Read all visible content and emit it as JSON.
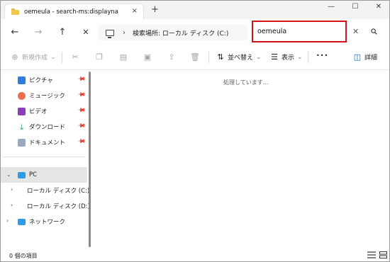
{
  "window": {
    "tab_title": "oemeula - search-ms:displayna",
    "tab_close": "×",
    "new_tab": "+",
    "controls": {
      "minimize": "—",
      "maximize": "☐",
      "close": "✕"
    }
  },
  "nav": {
    "back": "←",
    "forward": "→",
    "up": "↑",
    "stop": "✕",
    "address_chevron": "›",
    "address_text": "検索場所: ローカル ディスク (C:)",
    "search_value": "oemeula",
    "search_clear": "✕"
  },
  "commands": {
    "new": "新規作成",
    "new_chevron": "⌄",
    "sort": "並べ替え",
    "sort_chevron": "⌄",
    "view": "表示",
    "view_chevron": "⌄",
    "more": "•••",
    "details": "詳細"
  },
  "sidebar": {
    "quick": [
      {
        "label": "ピクチャ",
        "icon": "pictures-icon",
        "color": "#2f7de1"
      },
      {
        "label": "ミュージック",
        "icon": "music-icon",
        "color": "#e8704a"
      },
      {
        "label": "ビデオ",
        "icon": "videos-icon",
        "color": "#8a3fb8"
      },
      {
        "label": "ダウンロード",
        "icon": "downloads-icon",
        "color": "#1e9c5a"
      },
      {
        "label": "ドキュメント",
        "icon": "documents-icon",
        "color": "#7a8aa6"
      }
    ],
    "pc": "PC",
    "drive_c": "ローカル ディスク (C:)",
    "drive_d": "ローカル ディスク (D:)",
    "network": "ネットワーク"
  },
  "content": {
    "status_message": "処理しています..."
  },
  "statusbar": {
    "item_count": "0 個の項目"
  },
  "colors": {
    "highlight_border": "#d3121a",
    "selected_bg": "#e5e5e5",
    "accent_blue": "#0067c0"
  }
}
